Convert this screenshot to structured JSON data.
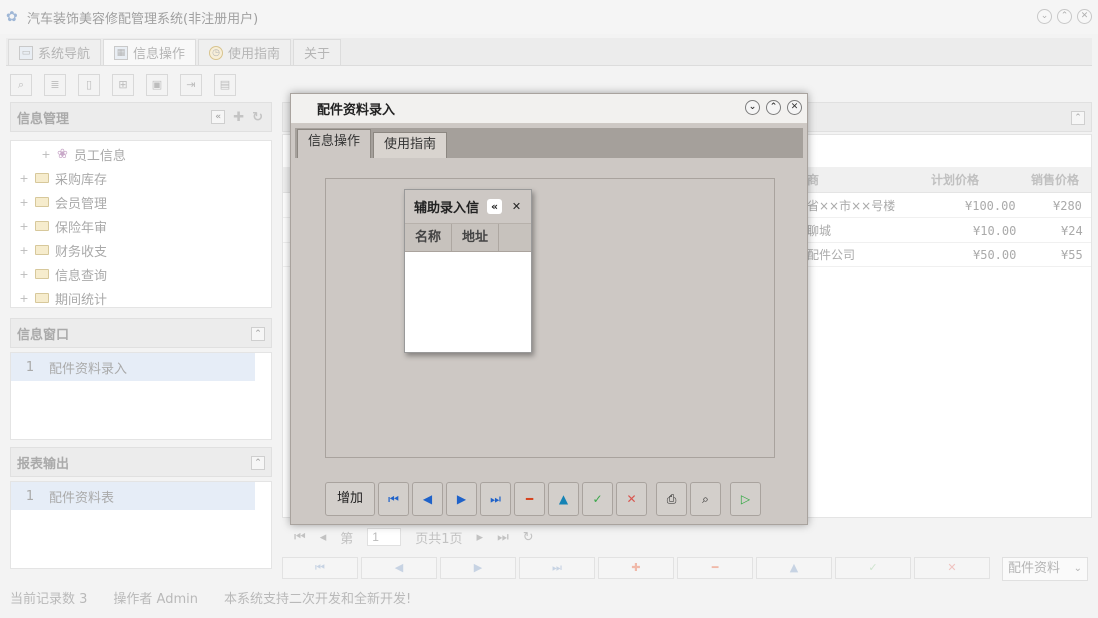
{
  "app": {
    "title": "汽车装饰美容修配管理系统(非注册用户)",
    "window_controls": [
      "chevron-down",
      "chevron-up",
      "close"
    ]
  },
  "tabs": [
    {
      "label": "系统导航",
      "icon": "monitor-icon"
    },
    {
      "label": "信息操作",
      "icon": "grid-icon"
    },
    {
      "label": "使用指南",
      "icon": "clock-icon"
    },
    {
      "label": "关于",
      "icon": ""
    }
  ],
  "panels": {
    "info_mgmt": {
      "title": "信息管理",
      "tree": [
        {
          "label": "员工信息",
          "indent": true
        },
        {
          "label": "采购库存"
        },
        {
          "label": "会员管理"
        },
        {
          "label": "保险年审"
        },
        {
          "label": "财务收支"
        },
        {
          "label": "信息查询"
        },
        {
          "label": "期间统计"
        }
      ]
    },
    "info_window": {
      "title": "信息窗口",
      "items": [
        {
          "num": "1",
          "label": "配件资料录入"
        }
      ]
    },
    "report": {
      "title": "报表输出",
      "items": [
        {
          "num": "1",
          "label": "配件资料表"
        }
      ]
    }
  },
  "grid": {
    "headers": [
      "商",
      "计划价格",
      "销售价格"
    ],
    "rows": [
      [
        "省××市××号楼",
        "¥100.00",
        "¥280"
      ],
      [
        "聊城",
        "¥10.00",
        "¥24"
      ],
      [
        "配件公司",
        "¥50.00",
        "¥55"
      ]
    ]
  },
  "pager": {
    "prefix": "第",
    "page": "1",
    "suffix": "页共1页"
  },
  "select": {
    "value": "配件资料"
  },
  "status": {
    "records": "当前记录数 3",
    "operator": "操作者 Admin",
    "note": "本系统支持二次开发和全新开发!"
  },
  "dialog": {
    "title": "配件资料录入",
    "tabs": [
      "信息操作",
      "使用指南"
    ],
    "sub_window": {
      "title": "辅助录入信",
      "columns": [
        "名称",
        "地址"
      ]
    },
    "buttons": {
      "add": "增加"
    }
  }
}
